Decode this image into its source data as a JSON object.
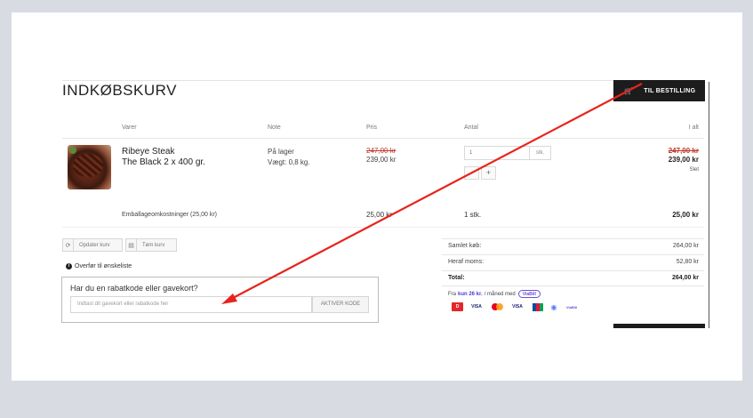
{
  "page_title": "INDKØBSKURV",
  "order_button": {
    "label": "TIL BESTILLING",
    "icon": "cart-icon"
  },
  "table_headers": {
    "items": "Varer",
    "note": "Note",
    "price": "Pris",
    "quantity": "Antal",
    "total": "I alt"
  },
  "product": {
    "name_line1": "Ribeye Steak",
    "name_line2": "The Black 2 x 400 gr.",
    "note_line1": "På lager",
    "note_line2": "Vægt: 0,8 kg.",
    "price_old": "247,00 kr",
    "price_new": "239,00 kr",
    "quantity_value": "1",
    "quantity_unit": "stk.",
    "decrement_label": "-",
    "increment_label": "+",
    "total_old": "247,00 kr",
    "total_new": "239,00 kr",
    "delete_label": "Slet"
  },
  "packaging": {
    "label": "Emballageomkostninger (25,00 kr)",
    "price": "25,00 kr",
    "quantity": "1 stk.",
    "total": "25,00 kr"
  },
  "cart_actions": {
    "update_label": "Opdater kurv",
    "empty_label": "Tøm kurv"
  },
  "wishlist_label": "Overfør til ønskeliste",
  "discount": {
    "title": "Har du en rabatkode eller gavekort?",
    "placeholder": "Indtast dit gavekort eller rabatkode her",
    "button_label": "AKTIVER KODE"
  },
  "summary": {
    "subtotal_label": "Samlet køb:",
    "subtotal_value": "264,00 kr",
    "vat_label": "Heraf moms:",
    "vat_value": "52,80 kr",
    "total_label": "Total:",
    "total_value": "264,00 kr"
  },
  "financing": {
    "prefix": "Fra",
    "amount": "kun 26 kr.",
    "suffix": "/ måned med",
    "provider": "ViaBill"
  },
  "payment_methods": [
    "Dankort",
    "VISA",
    "Mastercard",
    "VISA",
    "JCB",
    "MobilePay",
    "ViaBill"
  ],
  "colors": {
    "annotation_arrow": "#e8231d",
    "sale_price": "#c0392b",
    "viabill": "#6b4ed8",
    "button_dark": "#1c1c1c"
  }
}
